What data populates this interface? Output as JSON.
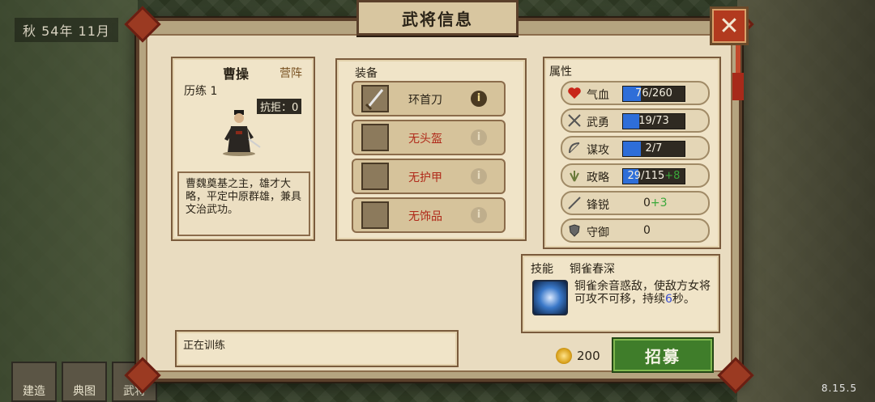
{
  "screen": {
    "date": "秋 54年 11月",
    "version": "8.15.5"
  },
  "dialog": {
    "title": "武将信息",
    "close_label": "✕"
  },
  "general": {
    "name": "曹操",
    "camp": "营阵",
    "experience": "历练 1",
    "resist": "抗拒：0",
    "description": "曹魏奠基之主，雄才大略，平定中原群雄，兼具文治武功。"
  },
  "equipment": {
    "title": "装备",
    "slots": [
      {
        "label": "环首刀",
        "equipped": true,
        "info": "i"
      },
      {
        "label": "无头盔",
        "equipped": false,
        "info": "i"
      },
      {
        "label": "无护甲",
        "equipped": false,
        "info": "i"
      },
      {
        "label": "无饰品",
        "equipped": false,
        "info": "i"
      }
    ]
  },
  "attributes": {
    "title": "属性",
    "hp": {
      "name": "气血",
      "value": "76/260",
      "fill": 0.29
    },
    "force": {
      "name": "武勇",
      "value": "19/73",
      "fill": 0.26
    },
    "intellect": {
      "name": "谋攻",
      "value": "2/7",
      "fill": 0.29
    },
    "strategy": {
      "name": "政略",
      "value": "29/115",
      "bonus": "+8",
      "fill": 0.25
    },
    "sharpness": {
      "name": "锋锐",
      "value": "0",
      "bonus": "+3"
    },
    "defense": {
      "name": "守御",
      "value": "0"
    }
  },
  "skill": {
    "label": "技能",
    "name": "铜雀春深",
    "desc_a": "铜雀余音惑敌，使敌方女将可攻不可移，持续",
    "desc_num": "6",
    "desc_b": "秒。"
  },
  "training": {
    "status": "正在训练"
  },
  "recruit": {
    "cost": "200",
    "label": "招募"
  },
  "bottom_menu": [
    "建造",
    "典图",
    "武将"
  ]
}
